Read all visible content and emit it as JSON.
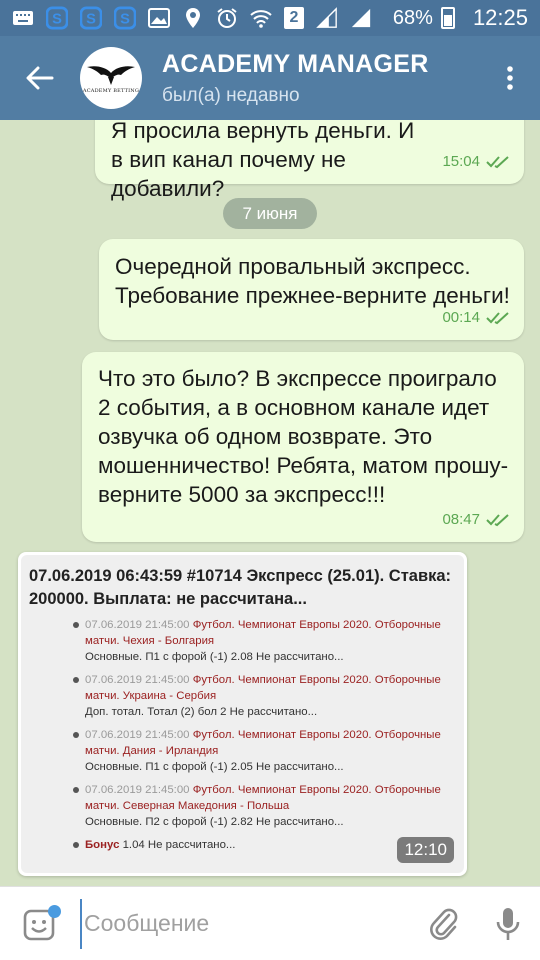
{
  "status_bar": {
    "icons_left": [
      "keyboard-icon",
      "s-app-icon",
      "s-app-icon",
      "s-app-icon",
      "image-icon",
      "location-icon",
      "alarm-icon",
      "wifi-icon",
      "sim2-icon",
      "signal-icon",
      "signal-icon"
    ],
    "sim_label": "2",
    "battery": "68%",
    "time": "12:25"
  },
  "header": {
    "title": "ACADEMY MANAGER",
    "subtitle": "был(а) недавно",
    "avatar_text": "ACADEMY BETTING",
    "colors": {
      "status_bar": "#4a739a",
      "app_bar": "#527da3"
    }
  },
  "chat": {
    "messages": [
      {
        "text": "Я просила вернуть деньги. И в вип канал почему не добавили?",
        "time": "15:04"
      },
      {
        "date_separator": "7 июня"
      },
      {
        "text": "Очередной провальный экспресс. Требование прежнее-верните деньги!",
        "time": "00:14"
      },
      {
        "text": "Что это было? В экспрессе проиграло 2 события, а в основном канале идет озвучка об одном возврате. Это мошенничество! Ребята, матом прошу- верните 5000 за экспресс!!!",
        "time": "08:47"
      }
    ],
    "image_message": {
      "header": "07.06.2019 06:43:59 #10714 Экспресс (25.01). Ставка: 200000. Выплата: не рассчитана...",
      "bets": [
        {
          "datetime": "07.06.2019 21:45:00",
          "event": "Футбол. Чемпионат Европы 2020. Отборочные матчи. Чехия - Болгария",
          "bet": "Основные. П1 с форой (-1) 2.08 Не рассчитано..."
        },
        {
          "datetime": "07.06.2019 21:45:00",
          "event": "Футбол. Чемпионат Европы 2020. Отборочные матчи. Украина - Сербия",
          "bet": "Доп. тотал. Тотал (2) бол 2 Не рассчитано..."
        },
        {
          "datetime": "07.06.2019 21:45:00",
          "event": "Футбол. Чемпионат Европы 2020. Отборочные матчи. Дания - Ирландия",
          "bet": "Основные. П1 с форой (-1) 2.05 Не рассчитано..."
        },
        {
          "datetime": "07.06.2019 21:45:00",
          "event": "Футбол. Чемпионат Европы 2020. Отборочные матчи. Северная Македония - Польша",
          "bet": "Основные. П2 с форой (-1) 2.82 Не рассчитано..."
        }
      ],
      "bonus": {
        "label": "Бонус",
        "value": "1.04 Не рассчитано..."
      },
      "time": "12:10"
    },
    "colors": {
      "bubble_out": "#effdde",
      "time_out": "#5ca853",
      "background": "#d5e2c5"
    }
  },
  "input_bar": {
    "placeholder": "Сообщение",
    "icons": [
      "emoji-icon",
      "attach-icon",
      "mic-icon"
    ]
  }
}
